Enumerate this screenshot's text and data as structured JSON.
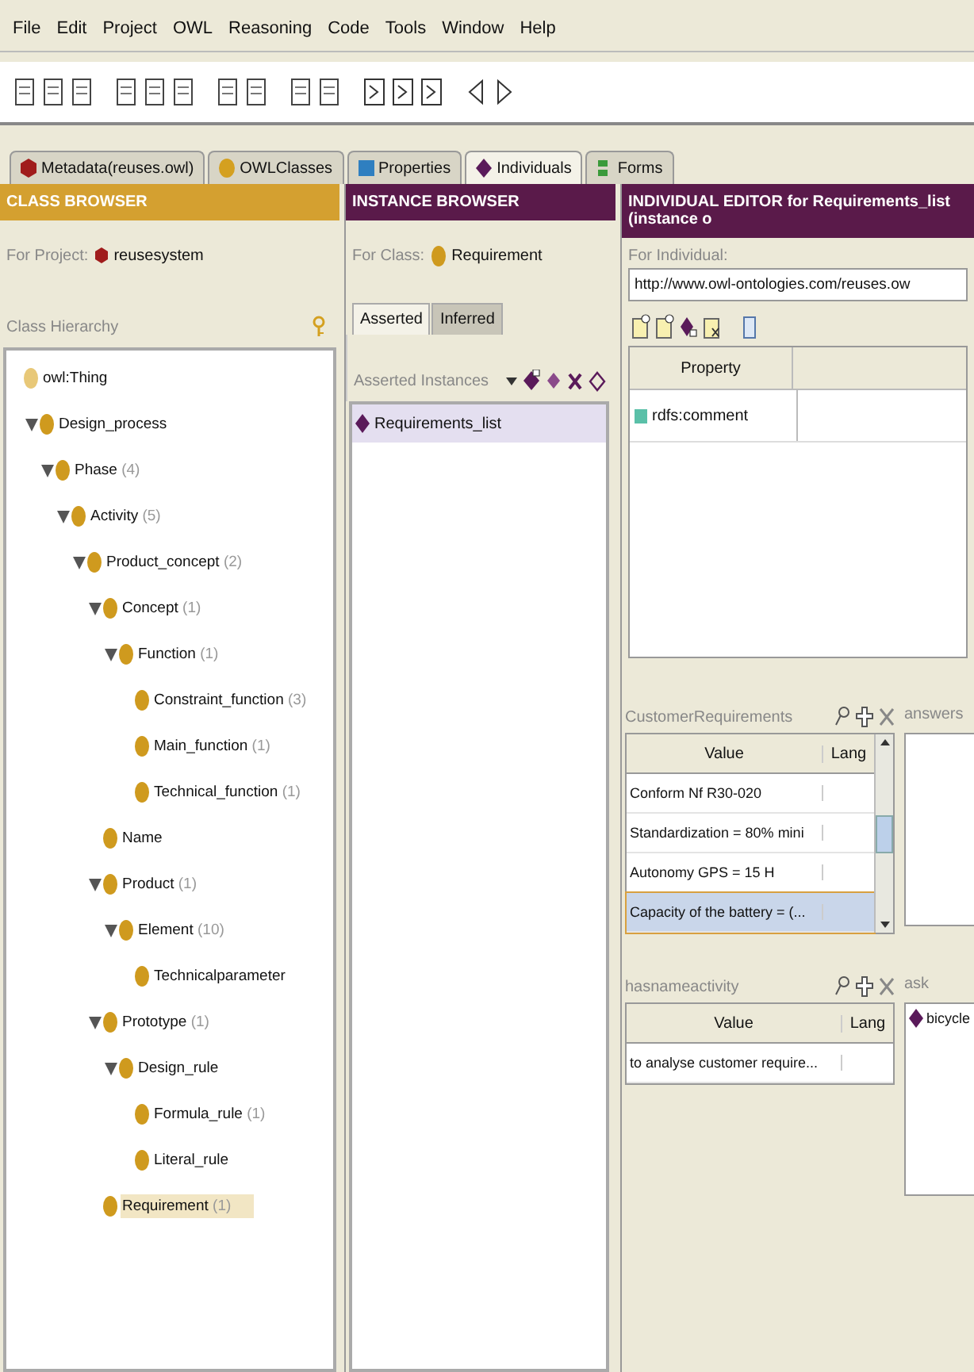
{
  "menu": [
    "File",
    "Edit",
    "Project",
    "OWL",
    "Reasoning",
    "Code",
    "Tools",
    "Window",
    "Help"
  ],
  "tabs": [
    {
      "label": "Metadata(reuses.owl)",
      "kind": "hexagon",
      "color": "#a01c1c",
      "selected": false
    },
    {
      "label": "OWLClasses",
      "kind": "circle",
      "color": "#d4a020",
      "selected": false
    },
    {
      "label": "Properties",
      "kind": "square",
      "color": "#2f7fc0",
      "selected": false
    },
    {
      "label": "Individuals",
      "kind": "diamond",
      "color": "#5a1a5a",
      "selected": true
    },
    {
      "label": "Forms",
      "kind": "bars",
      "color": "#3a9a3a",
      "selected": false
    }
  ],
  "class_browser": {
    "title": "CLASS BROWSER",
    "project_label": "For Project:",
    "project": "reusesystem",
    "hierarchy_label": "Class Hierarchy",
    "tree": [
      {
        "name": "owl:Thing",
        "selected": false,
        "children": [
          {
            "name": "Design_process",
            "expanded": true,
            "selected": false,
            "children": [
              {
                "name": "Phase",
                "count": "(4)",
                "expanded": true,
                "selected": false,
                "children": [
                  {
                    "name": "Activity",
                    "count": "(5)",
                    "expanded": true,
                    "selected": false,
                    "children": [
                      {
                        "name": "Product_concept",
                        "count": "(2)",
                        "expanded": true,
                        "selected": false,
                        "children": [
                          {
                            "name": "Concept",
                            "count": "(1)",
                            "expanded": true,
                            "selected": false,
                            "children": [
                              {
                                "name": "Function",
                                "count": "(1)",
                                "expanded": true,
                                "selected": false,
                                "children": [
                                  {
                                    "name": "Constraint_function",
                                    "count": "(3)",
                                    "selected": false
                                  },
                                  {
                                    "name": "Main_function",
                                    "count": "(1)",
                                    "selected": false
                                  },
                                  {
                                    "name": "Technical_function",
                                    "count": "(1)",
                                    "selected": false
                                  }
                                ]
                              }
                            ]
                          },
                          {
                            "name": "Name",
                            "selected": false
                          },
                          {
                            "name": "Product",
                            "count": "(1)",
                            "expanded": true,
                            "selected": false,
                            "children": [
                              {
                                "name": "Element",
                                "count": "(10)",
                                "expanded": true,
                                "selected": false,
                                "children": [
                                  {
                                    "name": "Technicalparameter",
                                    "selected": false
                                  }
                                ]
                              }
                            ]
                          },
                          {
                            "name": "Prototype",
                            "count": "(1)",
                            "expanded": true,
                            "selected": false,
                            "children": [
                              {
                                "name": "Design_rule",
                                "expanded": true,
                                "selected": false,
                                "children": [
                                  {
                                    "name": "Formula_rule",
                                    "count": "(1)",
                                    "selected": false
                                  },
                                  {
                                    "name": "Literal_rule",
                                    "selected": false
                                  }
                                ]
                              }
                            ]
                          },
                          {
                            "name": "Requirement",
                            "count": "(1)",
                            "selected": true
                          }
                        ]
                      }
                    ]
                  }
                ]
              }
            ]
          }
        ]
      }
    ]
  },
  "instance_browser": {
    "title": "INSTANCE BROWSER",
    "class_label": "For Class:",
    "class": "Requirement",
    "tabs": [
      {
        "label": "Asserted",
        "selected": true
      },
      {
        "label": "Inferred",
        "selected": false
      }
    ],
    "list_label": "Asserted Instances",
    "instances": [
      {
        "name": "Requirements_list",
        "selected": true
      }
    ]
  },
  "individual_editor": {
    "title": "INDIVIDUAL EDITOR for Requirements_list  (instance o",
    "individual_label": "For Individual:",
    "individual_uri": "http://www.owl-ontologies.com/reuses.ow",
    "property_table": {
      "columns": [
        "Property"
      ],
      "rows": [
        "rdfs:comment"
      ]
    },
    "widgets": [
      {
        "label": "CustomerRequirements",
        "kind": "table",
        "columns": [
          "Value",
          "Lang"
        ],
        "rows": [
          {
            "value": "Conform Nf R30-020",
            "selected": false
          },
          {
            "value": "Standardization = 80% mini",
            "selected": false
          },
          {
            "value": "Autonomy GPS = 15 H",
            "selected": false
          },
          {
            "value": "Capacity of the battery = (...",
            "selected": true
          }
        ]
      },
      {
        "label": "answers",
        "kind": "list"
      },
      {
        "label": "hasnameactivity",
        "kind": "table",
        "columns": [
          "Value",
          "Lang"
        ],
        "rows": [
          {
            "value": "to analyse customer require...",
            "selected": false
          }
        ]
      },
      {
        "label": "ask",
        "kind": "list",
        "items": [
          "bicycle"
        ]
      }
    ]
  }
}
